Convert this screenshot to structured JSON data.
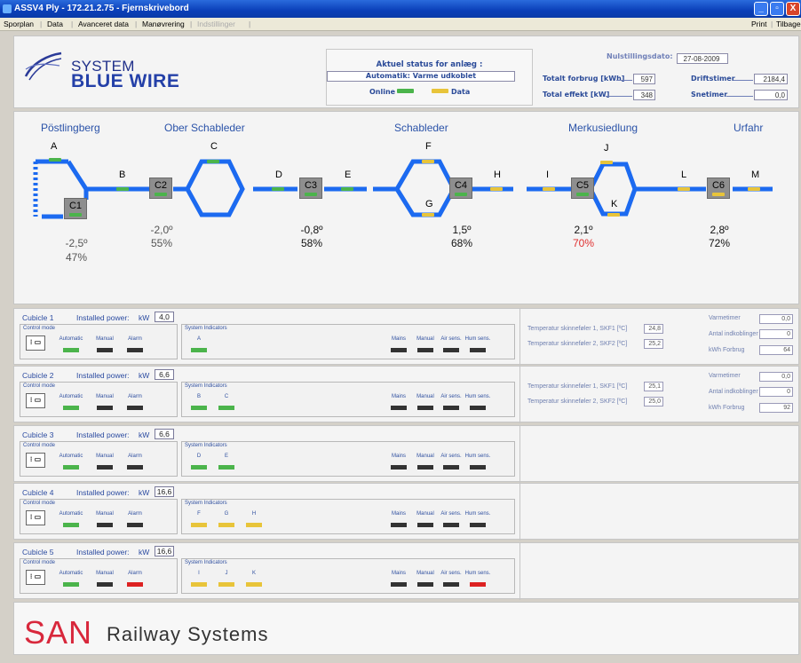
{
  "window": {
    "title": "ASSV4 Ply - 172.21.2.75 - Fjernskrivebord",
    "buttons": [
      "_",
      "▫",
      "X"
    ]
  },
  "menu": {
    "items": [
      "Sporplan",
      "Data",
      "Avanceret data",
      "Manøvrering",
      "Indstillinger"
    ],
    "right": [
      "Print",
      "Tilbage"
    ]
  },
  "brand": {
    "system": "SYSTEM",
    "bluewire": "BLUE WIRE"
  },
  "status": {
    "title": "Aktuel status for anlæg :",
    "value": "Automatik: Varme udkoblet",
    "online_label": "Online",
    "data_label": "Data"
  },
  "metrics": {
    "date_label": "Nulstillingsdato:",
    "date_value": "27-08-2009",
    "total_usage_label": "Totalt forbrug [kWh]",
    "total_usage_value": "597",
    "total_power_label": "Total effekt [kW]",
    "total_power_value": "348",
    "runtime_label": "Driftstimer",
    "runtime_value": "2184,4",
    "snow_label": "Snetimer",
    "snow_value": "0,0"
  },
  "diagram": {
    "stations": [
      "Pöstlingberg",
      "Ober Schableder",
      "Schableder",
      "Merkusiedlung",
      "Urfahr"
    ],
    "letters": [
      "A",
      "B",
      "C",
      "D",
      "E",
      "F",
      "G",
      "H",
      "I",
      "J",
      "K",
      "L",
      "M"
    ],
    "cubicles": [
      {
        "label": "C1",
        "temp": "-2,5º",
        "pct": "47%",
        "led": "green"
      },
      {
        "label": "C2",
        "temp": "-2,0º",
        "pct": "55%",
        "led": "green"
      },
      {
        "label": "C3",
        "temp": "-0,8º",
        "pct": "58%",
        "led": "green"
      },
      {
        "label": "C4",
        "temp": "1,5º",
        "pct": "68%",
        "led": "green"
      },
      {
        "label": "C5",
        "temp": "2,1º",
        "pct": "70%",
        "led": "green"
      },
      {
        "label": "C6",
        "temp": "2,8º",
        "pct": "72%",
        "led": "yellow"
      }
    ]
  },
  "cubicle_labels": {
    "installed": "Installed power:",
    "kw": "kW",
    "control_mode": "Control mode",
    "system_indicators": "System Indicators",
    "automatic": "Automatic",
    "manual": "Manual",
    "alarm": "Alarm",
    "mains": "Mains",
    "air": "Air sens.",
    "hum": "Hum sens."
  },
  "cubicles": [
    {
      "title": "Cubicle 1",
      "power": "4,0",
      "indicators": [
        "A"
      ],
      "auto": "green",
      "alarm": "black",
      "hum": "black",
      "right": {
        "t1_label": "Temperatur skinneføler 1, SKF1 [ºC]",
        "t1": "24,8",
        "t2_label": "Temperatur skinneføler 2, SKF2 [ºC]",
        "t2": "25,2",
        "varme_label": "Varmetimer",
        "varme": "0,0",
        "ind_label": "Antal indkoblinger",
        "ind": "0",
        "kwh_label": "kWh Forbrug",
        "kwh": "64"
      }
    },
    {
      "title": "Cubicle 2",
      "power": "6,6",
      "indicators": [
        "B",
        "C"
      ],
      "auto": "green",
      "alarm": "black",
      "hum": "black",
      "right": {
        "t1_label": "Temperatur skinneføler 1, SKF1 [ºC]",
        "t1": "25,1",
        "t2_label": "Temperatur skinneføler 2, SKF2 [ºC]",
        "t2": "25,0",
        "varme_label": "Varmetimer",
        "varme": "0,0",
        "ind_label": "Antal indkoblinger",
        "ind": "0",
        "kwh_label": "kWh Forbrug",
        "kwh": "92"
      }
    },
    {
      "title": "Cubicle 3",
      "power": "6,6",
      "indicators": [
        "D",
        "E"
      ],
      "auto": "green",
      "alarm": "black",
      "hum": "black"
    },
    {
      "title": "Cubicle 4",
      "power": "16,6",
      "indicators": [
        "F",
        "G",
        "H"
      ],
      "auto": "green",
      "alarm": "black",
      "hum": "black"
    },
    {
      "title": "Cubicle 5",
      "power": "16,6",
      "indicators": [
        "I",
        "J",
        "K"
      ],
      "auto": "green",
      "alarm": "red",
      "hum": "red"
    }
  ],
  "footer": {
    "san": "SAN",
    "rest": "Railway Systems"
  }
}
